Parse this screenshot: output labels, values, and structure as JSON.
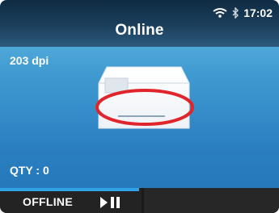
{
  "header": {
    "title": "Online",
    "time": "17:02",
    "icons": [
      "wifi-icon",
      "bluetooth-icon"
    ]
  },
  "info": {
    "resolution": "203 dpi",
    "quantity": "QTY : 0"
  },
  "softkeys": {
    "left_label": "OFFLINE",
    "left_icon": "play-pause-icon",
    "right_label": ""
  },
  "colors": {
    "header": "#1b3f5c",
    "background": "#3f9ad0",
    "highlight_circle": "#e0262b",
    "softkey_accent": "#2fa3e6"
  }
}
